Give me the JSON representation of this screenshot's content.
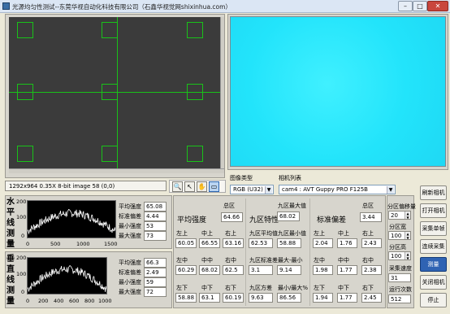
{
  "window": {
    "title": "光源均匀性测试--东莞华视自动化科技有限公司（石鑫华视觉网shixinhua.com）",
    "minimize": "–",
    "maximize": "□",
    "close": "✕"
  },
  "left_cam": {
    "status": "1292x964 0.35X 8-bit image 58     (0,0)"
  },
  "tools": [
    "🔍",
    "↖",
    "✋",
    "▭"
  ],
  "camera": {
    "type_label": "图像类型",
    "type_value": "RGB (U32)",
    "list_label": "相机列表",
    "list_value": "cam4 : AVT Guppy PRO F125B",
    "refresh": "刷新相机",
    "open": "打开相机",
    "single": "采集单帧",
    "continuous": "连续采集",
    "measure": "测量",
    "close": "关闭相机",
    "stop": "停止"
  },
  "params": {
    "shift_label": "分区偏移量",
    "shift_value": "20",
    "width_label": "分区宽",
    "width_value": "100",
    "height_label": "分区高",
    "height_value": "100",
    "speed_label": "采集速度",
    "speed_value": "31",
    "runs_label": "运行次数",
    "runs_value": "512"
  },
  "horiz": {
    "title": [
      "水",
      "平",
      "线",
      "测",
      "量"
    ],
    "stats": [
      {
        "label": "平均强度",
        "value": "65.08"
      },
      {
        "label": "标准偏差",
        "value": "4.44"
      },
      {
        "label": "最小强度",
        "value": "53"
      },
      {
        "label": "最大强度",
        "value": "73"
      }
    ],
    "yticks": [
      "200",
      "100",
      "0"
    ],
    "xticks": [
      "0",
      "500",
      "1000",
      "1500"
    ]
  },
  "vert": {
    "title": [
      "垂",
      "直",
      "线",
      "测",
      "量"
    ],
    "stats": [
      {
        "label": "平均强度",
        "value": "66.3"
      },
      {
        "label": "标准偏差",
        "value": "2.49"
      },
      {
        "label": "最小强度",
        "value": "59"
      },
      {
        "label": "最大强度",
        "value": "72"
      }
    ],
    "yticks": [
      "200",
      "100",
      "0"
    ],
    "xticks": [
      "0",
      "200",
      "400",
      "600",
      "800",
      "1000"
    ]
  },
  "avg": {
    "title": "平均强度",
    "total_label": "总区",
    "total": "64.66",
    "tl_label": "左上",
    "tm_label": "中上",
    "tr_label": "右上",
    "tl": "60.05",
    "tm": "66.55",
    "tr": "63.16",
    "ml_label": "左中",
    "mm_label": "中中",
    "mr_label": "右中",
    "ml": "60.29",
    "mm": "68.02",
    "mr": "62.5",
    "bl_label": "左下",
    "bm_label": "中下",
    "br_label": "右下",
    "bl": "58.88",
    "bm": "63.1",
    "br": "60.19"
  },
  "nine": {
    "title": "九区特性",
    "max_label": "九区最大值",
    "max": "68.02",
    "avg_label": "九区平均值",
    "avg": "62.53",
    "min_label": "九区最小值",
    "min": "58.88",
    "std_label": "九区标准差",
    "std": "3.1",
    "diff_label": "最大-最小",
    "diff": "9.14",
    "var_label": "九区方差",
    "var": "9.63",
    "ratio_label": "最小/最大%",
    "ratio": "86.56"
  },
  "std": {
    "title": "标准偏差",
    "total_label": "总区",
    "total": "3.44",
    "tl_label": "左上",
    "tm_label": "中上",
    "tr_label": "右上",
    "tl": "2.04",
    "tm": "1.76",
    "tr": "2.43",
    "ml_label": "左中",
    "mm_label": "中中",
    "mr_label": "右中",
    "ml": "1.98",
    "mm": "1.77",
    "mr": "2.38",
    "bl_label": "左下",
    "bm_label": "中下",
    "br_label": "右下",
    "bl": "1.94",
    "bm": "1.77",
    "br": "2.45"
  }
}
